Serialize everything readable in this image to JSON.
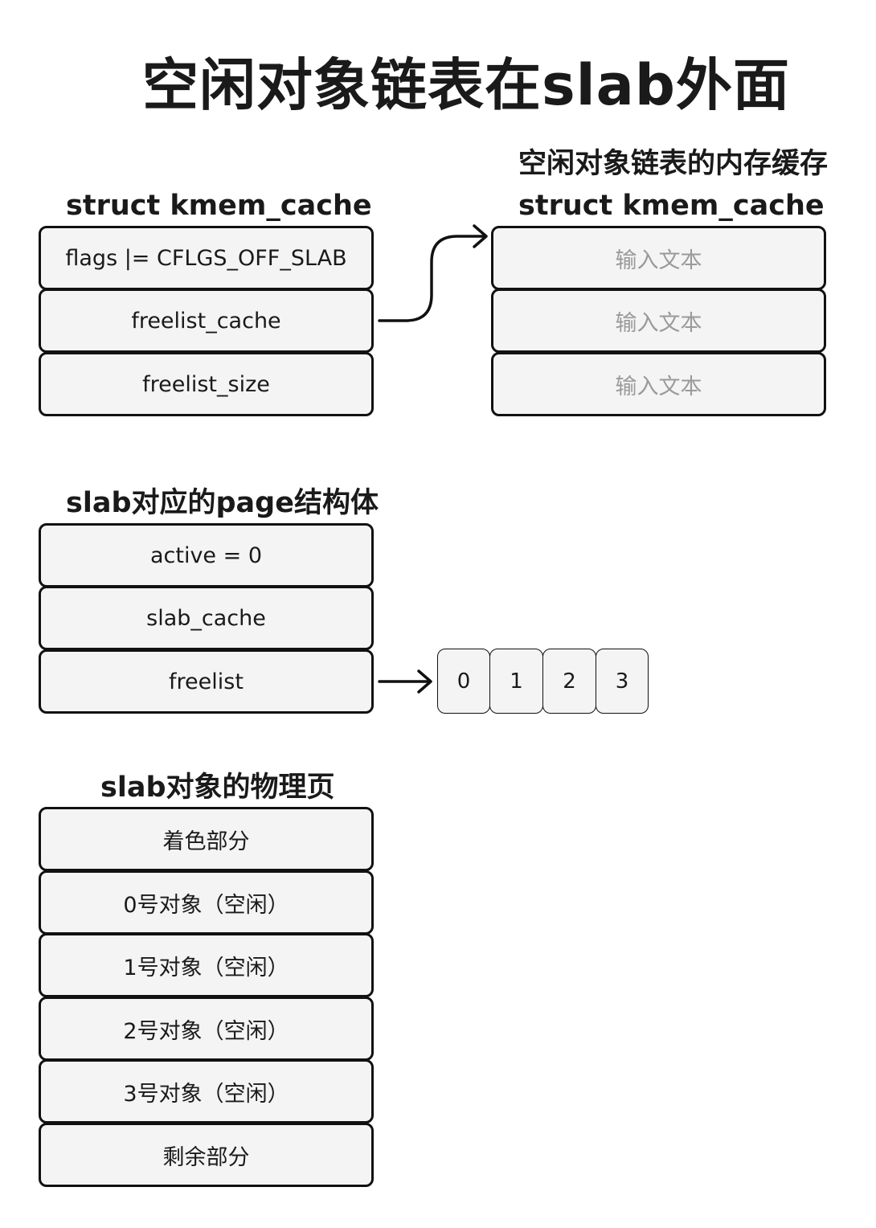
{
  "title": "空闲对象链表在slab外面",
  "kmem_cache": {
    "label": "struct kmem_cache",
    "fields": [
      "flags |= CFLGS_OFF_SLAB",
      "freelist_cache",
      "freelist_size"
    ]
  },
  "freelist_cache": {
    "caption": "空闲对象链表的内存缓存",
    "label": "struct kmem_cache",
    "fields": [
      "输入文本",
      "输入文本",
      "输入文本"
    ]
  },
  "page_struct": {
    "label": "slab对应的page结构体",
    "fields": [
      "active = 0",
      "slab_cache",
      "freelist"
    ]
  },
  "freelist_array": [
    "0",
    "1",
    "2",
    "3"
  ],
  "physical_page": {
    "label": "slab对象的物理页",
    "fields": [
      "着色部分",
      "0号对象（空闲）",
      "1号对象（空闲）",
      "2号对象（空闲）",
      "3号对象（空闲）",
      "剩余部分"
    ]
  }
}
